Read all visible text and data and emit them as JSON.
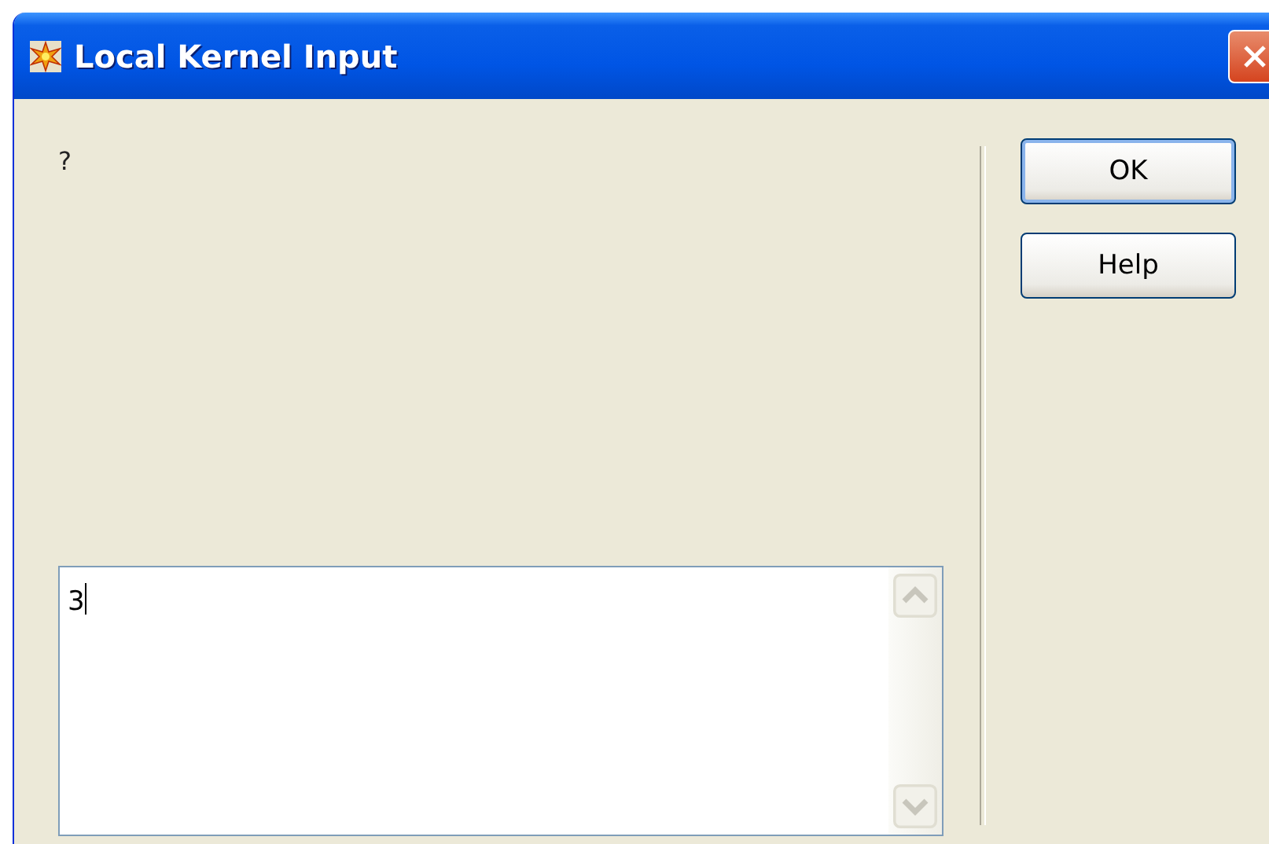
{
  "window": {
    "title": "Local Kernel Input"
  },
  "prompt": "?",
  "input": {
    "value": "3"
  },
  "buttons": [
    {
      "label": "OK",
      "default": true
    },
    {
      "label": "Help",
      "default": false
    }
  ]
}
